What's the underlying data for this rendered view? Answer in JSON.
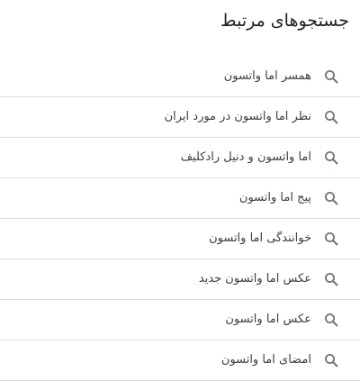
{
  "related": {
    "title": "جستجوهای مرتبط",
    "items": [
      {
        "label": "همسر اما واتسون",
        "icon": "search-icon"
      },
      {
        "label": "نظر اما واتسون در مورد ایران",
        "icon": "search-icon"
      },
      {
        "label": "اما واتسون و دنیل رادکلیف",
        "icon": "search-icon"
      },
      {
        "label": "پیج اما واتسون",
        "icon": "search-icon"
      },
      {
        "label": "خوانندگی اما واتسون",
        "icon": "search-icon"
      },
      {
        "label": "عکس اما واتسون جدید",
        "icon": "search-icon"
      },
      {
        "label": "عکس اما واتسون",
        "icon": "search-icon"
      },
      {
        "label": "امضای اما واتسون",
        "icon": "search-icon"
      }
    ]
  },
  "colors": {
    "text": "#202124",
    "label": "#3c4043",
    "divider": "#dadce0",
    "icon": "#70757a"
  }
}
